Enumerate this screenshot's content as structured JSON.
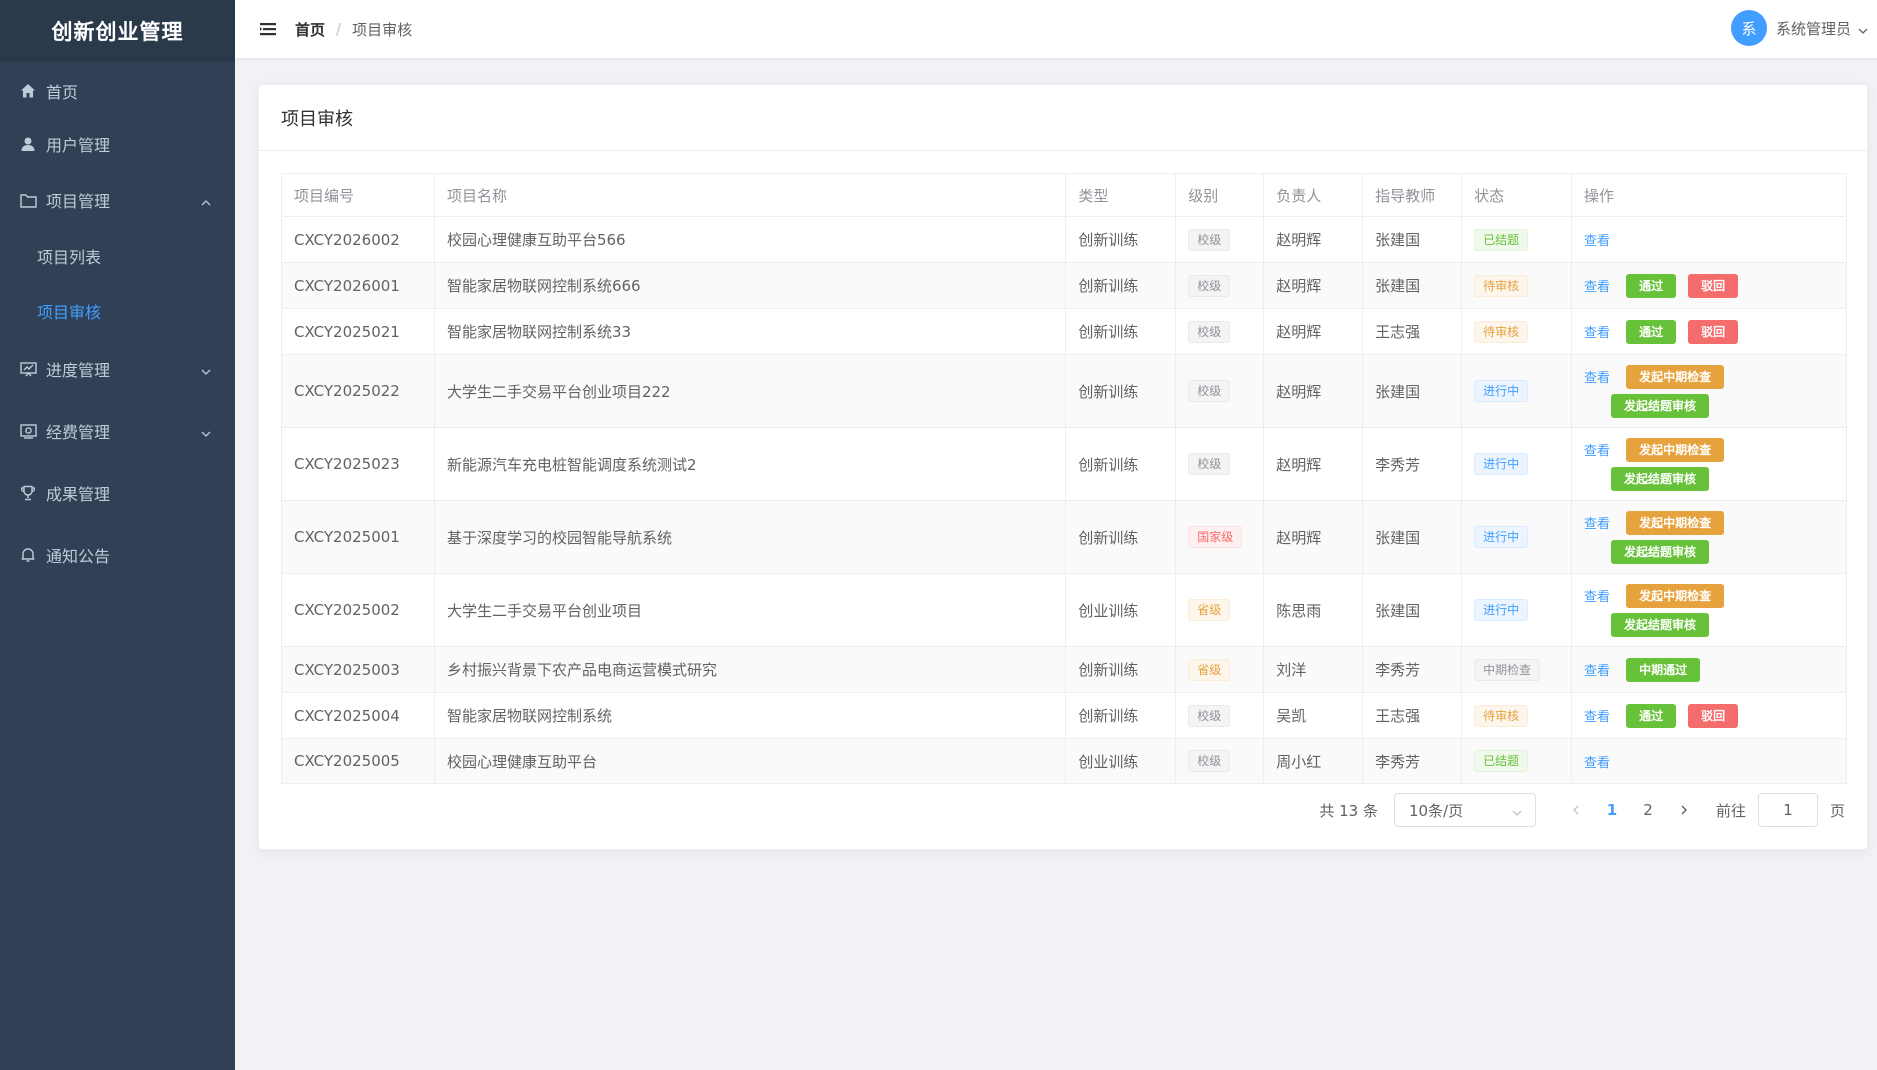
{
  "app": {
    "title": "创新创业管理"
  },
  "sidebar": {
    "items": [
      {
        "label": "首页",
        "icon": "home-icon"
      },
      {
        "label": "用户管理",
        "icon": "user-icon"
      },
      {
        "label": "项目管理",
        "icon": "folder-icon",
        "expanded": true,
        "children": [
          {
            "label": "项目列表"
          },
          {
            "label": "项目审核",
            "active": true
          }
        ]
      },
      {
        "label": "进度管理",
        "icon": "progress-icon"
      },
      {
        "label": "经费管理",
        "icon": "money-icon"
      },
      {
        "label": "成果管理",
        "icon": "trophy-icon"
      },
      {
        "label": "通知公告",
        "icon": "bell-icon"
      }
    ]
  },
  "header": {
    "breadcrumb": {
      "home": "首页",
      "sep": "/",
      "current": "项目审核"
    },
    "user": {
      "avatar_text": "系",
      "name": "系统管理员"
    }
  },
  "card": {
    "title": "项目审核"
  },
  "table": {
    "headers": [
      "项目编号",
      "项目名称",
      "类型",
      "级别",
      "负责人",
      "指导教师",
      "状态",
      "操作"
    ],
    "rows": [
      {
        "id": "CXCY2026002",
        "name": "校园心理健康互助平台566",
        "type": "创新训练",
        "level": "校级",
        "leader": "赵明辉",
        "teacher": "张建国",
        "status": "已结题",
        "actions": [
          "查看"
        ]
      },
      {
        "id": "CXCY2026001",
        "name": "智能家居物联网控制系统666",
        "type": "创新训练",
        "level": "校级",
        "leader": "赵明辉",
        "teacher": "张建国",
        "status": "待审核",
        "actions": [
          "查看",
          "通过",
          "驳回"
        ]
      },
      {
        "id": "CXCY2025021",
        "name": "智能家居物联网控制系统33",
        "type": "创新训练",
        "level": "校级",
        "leader": "赵明辉",
        "teacher": "王志强",
        "status": "待审核",
        "actions": [
          "查看",
          "通过",
          "驳回"
        ]
      },
      {
        "id": "CXCY2025022",
        "name": "大学生二手交易平台创业项目222",
        "type": "创新训练",
        "level": "校级",
        "leader": "赵明辉",
        "teacher": "张建国",
        "status": "进行中",
        "actions": [
          "查看",
          "发起中期检查",
          "发起结题审核"
        ]
      },
      {
        "id": "CXCY2025023",
        "name": "新能源汽车充电桩智能调度系统测试2",
        "type": "创新训练",
        "level": "校级",
        "leader": "赵明辉",
        "teacher": "李秀芳",
        "status": "进行中",
        "actions": [
          "查看",
          "发起中期检查",
          "发起结题审核"
        ]
      },
      {
        "id": "CXCY2025001",
        "name": "基于深度学习的校园智能导航系统",
        "type": "创新训练",
        "level": "国家级",
        "leader": "赵明辉",
        "teacher": "张建国",
        "status": "进行中",
        "actions": [
          "查看",
          "发起中期检查",
          "发起结题审核"
        ]
      },
      {
        "id": "CXCY2025002",
        "name": "大学生二手交易平台创业项目",
        "type": "创业训练",
        "level": "省级",
        "leader": "陈思雨",
        "teacher": "张建国",
        "status": "进行中",
        "actions": [
          "查看",
          "发起中期检查",
          "发起结题审核"
        ]
      },
      {
        "id": "CXCY2025003",
        "name": "乡村振兴背景下农产品电商运营模式研究",
        "type": "创新训练",
        "level": "省级",
        "leader": "刘洋",
        "teacher": "李秀芳",
        "status": "中期检查",
        "actions": [
          "查看",
          "中期通过"
        ]
      },
      {
        "id": "CXCY2025004",
        "name": "智能家居物联网控制系统",
        "type": "创新训练",
        "level": "校级",
        "leader": "吴凯",
        "teacher": "王志强",
        "status": "待审核",
        "actions": [
          "查看",
          "通过",
          "驳回"
        ]
      },
      {
        "id": "CXCY2025005",
        "name": "校园心理健康互助平台",
        "type": "创业训练",
        "level": "校级",
        "leader": "周小红",
        "teacher": "李秀芳",
        "status": "已结题",
        "actions": [
          "查看"
        ]
      }
    ]
  },
  "pagination": {
    "total": "共 13 条",
    "page_size": "10条/页",
    "pages": [
      "1",
      "2"
    ],
    "current": "1",
    "goto_label": "前往",
    "goto_value": "1",
    "page_suffix": "页"
  },
  "colors": {
    "sidebar_bg": "#304156",
    "logo_bg": "#2b3a4b",
    "primary": "#409eff",
    "success": "#67c23a",
    "danger": "#f56c6c",
    "warning": "#e6a23c"
  }
}
